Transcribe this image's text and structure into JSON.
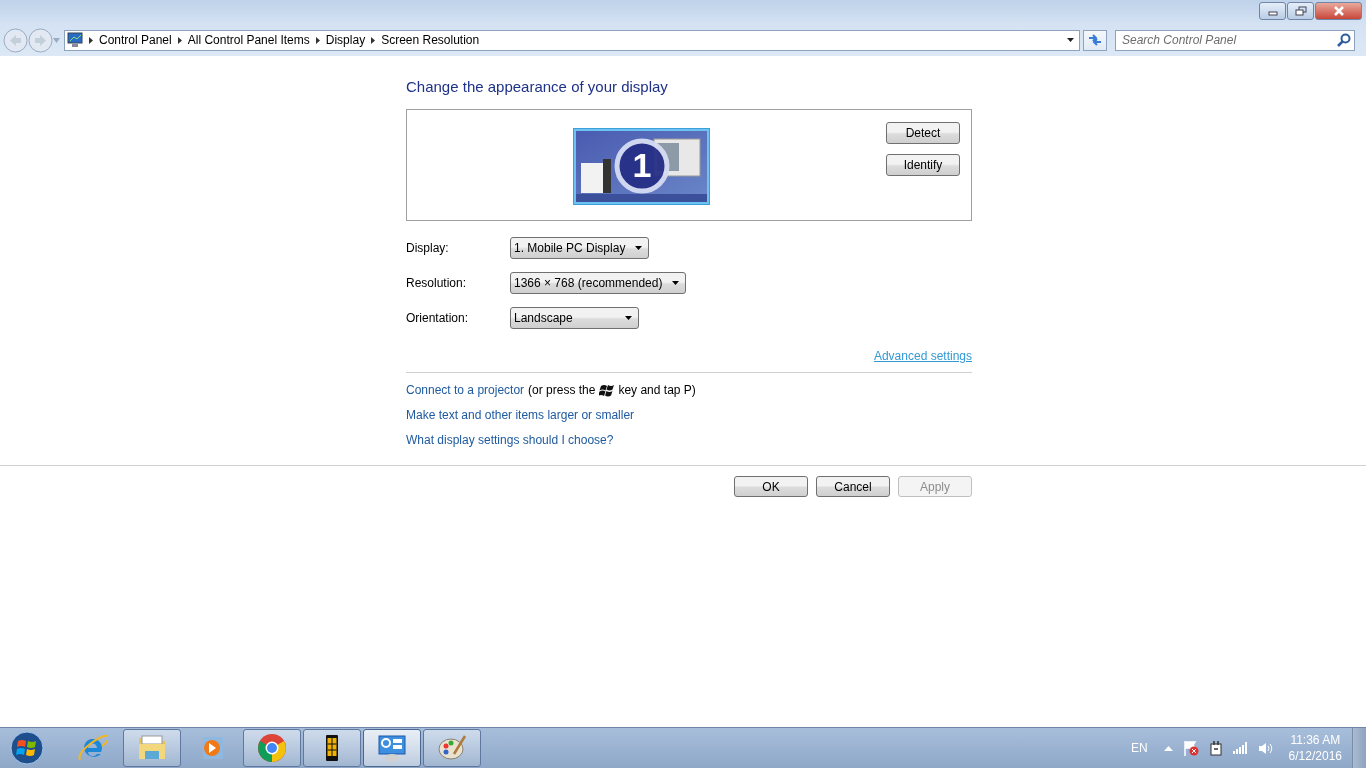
{
  "address_bar": {
    "breadcrumbs": [
      "Control Panel",
      "All Control Panel Items",
      "Display",
      "Screen Resolution"
    ]
  },
  "search": {
    "placeholder": "Search Control Panel"
  },
  "heading": "Change the appearance of your display",
  "preview": {
    "monitor_number": "1",
    "selected": true
  },
  "preview_buttons": [
    "Detect",
    "Identify"
  ],
  "settings": [
    {
      "label": "Display:",
      "value": "1. Mobile PC Display"
    },
    {
      "label": "Resolution:",
      "value": "1366 × 768 (recommended)"
    },
    {
      "label": "Orientation:",
      "value": "Landscape"
    }
  ],
  "advanced_link": "Advanced settings",
  "projector_line": {
    "link": "Connect to a projector",
    "text_before_key": "(or press the",
    "text_after_key": "key and tap P)"
  },
  "links": [
    "Make text and other items larger or smaller",
    "What display settings should I choose?"
  ],
  "dialog_buttons": [
    {
      "label": "OK",
      "disabled": false
    },
    {
      "label": "Cancel",
      "disabled": false
    },
    {
      "label": "Apply",
      "disabled": true
    }
  ],
  "taskbar": {
    "apps": [
      {
        "kind": "ie",
        "running": false,
        "selected": false
      },
      {
        "kind": "folder",
        "running": true,
        "selected": false
      },
      {
        "kind": "media",
        "running": false,
        "selected": false
      },
      {
        "kind": "chrome",
        "running": true,
        "selected": false
      },
      {
        "kind": "phone",
        "running": true,
        "selected": false
      },
      {
        "kind": "panel",
        "running": true,
        "selected": true
      },
      {
        "kind": "paint",
        "running": true,
        "selected": false
      }
    ]
  },
  "tray": {
    "language": "EN",
    "time": "11:36 AM",
    "date": "6/12/2016"
  }
}
